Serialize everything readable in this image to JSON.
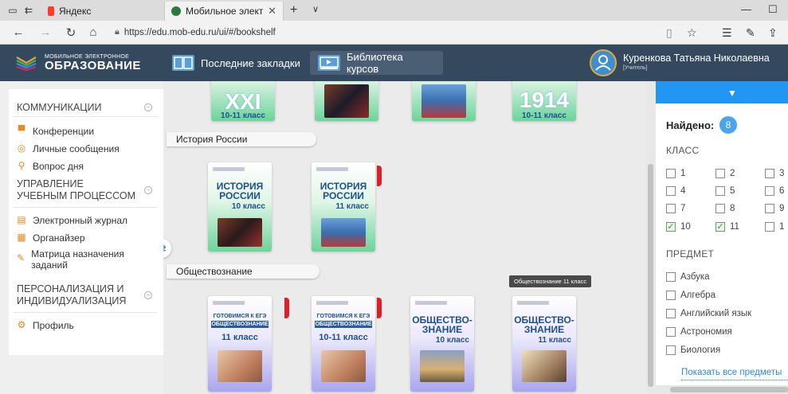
{
  "browser": {
    "tabs": [
      {
        "title": "Яндекс"
      },
      {
        "title": "Мобильное электронн"
      }
    ],
    "url": "https://edu.mob-edu.ru/ui/#/bookshelf"
  },
  "header": {
    "logo_small": "МОБИЛЬНОЕ ЭЛЕКТРОННОЕ",
    "logo_big": "ОБРАЗОВАНИЕ",
    "nav": [
      {
        "label": "Последние закладки"
      },
      {
        "label": "Библиотека курсов"
      }
    ],
    "user_name": "Куренкова Татьяна Николаевна",
    "user_role": "[Учитель]"
  },
  "sidebar": {
    "sections": [
      {
        "title": "КОММУНИКАЦИИ"
      },
      {
        "title": "УПРАВЛЕНИЕ УЧЕБНЫМ ПРОЦЕССОМ"
      },
      {
        "title": "ПЕРСОНАЛИЗАЦИЯ И ИНДИВИДУАЛИЗАЦИЯ"
      }
    ],
    "items": [
      {
        "label": "Конференции",
        "icon": "conference-icon"
      },
      {
        "label": "Личные сообщения",
        "icon": "messages-icon"
      },
      {
        "label": "Вопрос дня",
        "icon": "question-search-icon"
      },
      {
        "label": "Электронный журнал",
        "icon": "journal-icon"
      },
      {
        "label": "Органайзер",
        "icon": "calendar-icon"
      },
      {
        "label": "Матрица назначения заданий",
        "icon": "edit-icon"
      },
      {
        "label": "Профиль",
        "icon": "gear-icon"
      }
    ]
  },
  "main": {
    "top_books": [
      {
        "title": "XXI",
        "class": "10-11 класс"
      },
      {
        "title": "1914",
        "class": "10-11 класс"
      }
    ],
    "sections": [
      {
        "title": "История России"
      },
      {
        "title": "Обществознание"
      }
    ],
    "history_books": [
      {
        "title1": "ИСТОРИЯ",
        "title2": "РОССИИ",
        "class": "10 класс"
      },
      {
        "title1": "ИСТОРИЯ",
        "title2": "РОССИИ",
        "class": "11 класс"
      }
    ],
    "social_books": [
      {
        "sub": "ГОТОВИМСЯ К ЕГЭ",
        "bar": "ОБЩЕСТВОЗНАНИЕ",
        "class": "11 класс"
      },
      {
        "sub": "ГОТОВИМСЯ К ЕГЭ",
        "bar": "ОБЩЕСТВОЗНАНИЕ",
        "class": "10-11 класс"
      },
      {
        "title1": "ОБЩЕСТВО-",
        "title2": "ЗНАНИЕ",
        "class": "10 класс"
      },
      {
        "title1": "ОБЩЕСТВО-",
        "title2": "ЗНАНИЕ",
        "class": "11 класс"
      }
    ],
    "tooltip": "Обществознание 11 класс"
  },
  "filter": {
    "found_label": "Найдено:",
    "found_count": "8",
    "class_heading": "КЛАСС",
    "classes": [
      {
        "label": "1",
        "checked": false
      },
      {
        "label": "2",
        "checked": false
      },
      {
        "label": "3",
        "checked": false
      },
      {
        "label": "4",
        "checked": false
      },
      {
        "label": "5",
        "checked": false
      },
      {
        "label": "6",
        "checked": false
      },
      {
        "label": "7",
        "checked": false
      },
      {
        "label": "8",
        "checked": false
      },
      {
        "label": "9",
        "checked": false
      },
      {
        "label": "10",
        "checked": true
      },
      {
        "label": "11",
        "checked": true
      },
      {
        "label": "1",
        "checked": false
      }
    ],
    "subject_heading": "ПРЕДМЕТ",
    "subjects": [
      {
        "label": "Азбука"
      },
      {
        "label": "Алгебра"
      },
      {
        "label": "Английский язык"
      },
      {
        "label": "Астрономия"
      },
      {
        "label": "Биология"
      }
    ],
    "show_all": "Показать все предметы"
  },
  "colors": {
    "header_bg": "#34495e",
    "accent_blue": "#2196f3",
    "sidebar_icon": "#e58a25",
    "flag_red": "#e11d2a"
  }
}
